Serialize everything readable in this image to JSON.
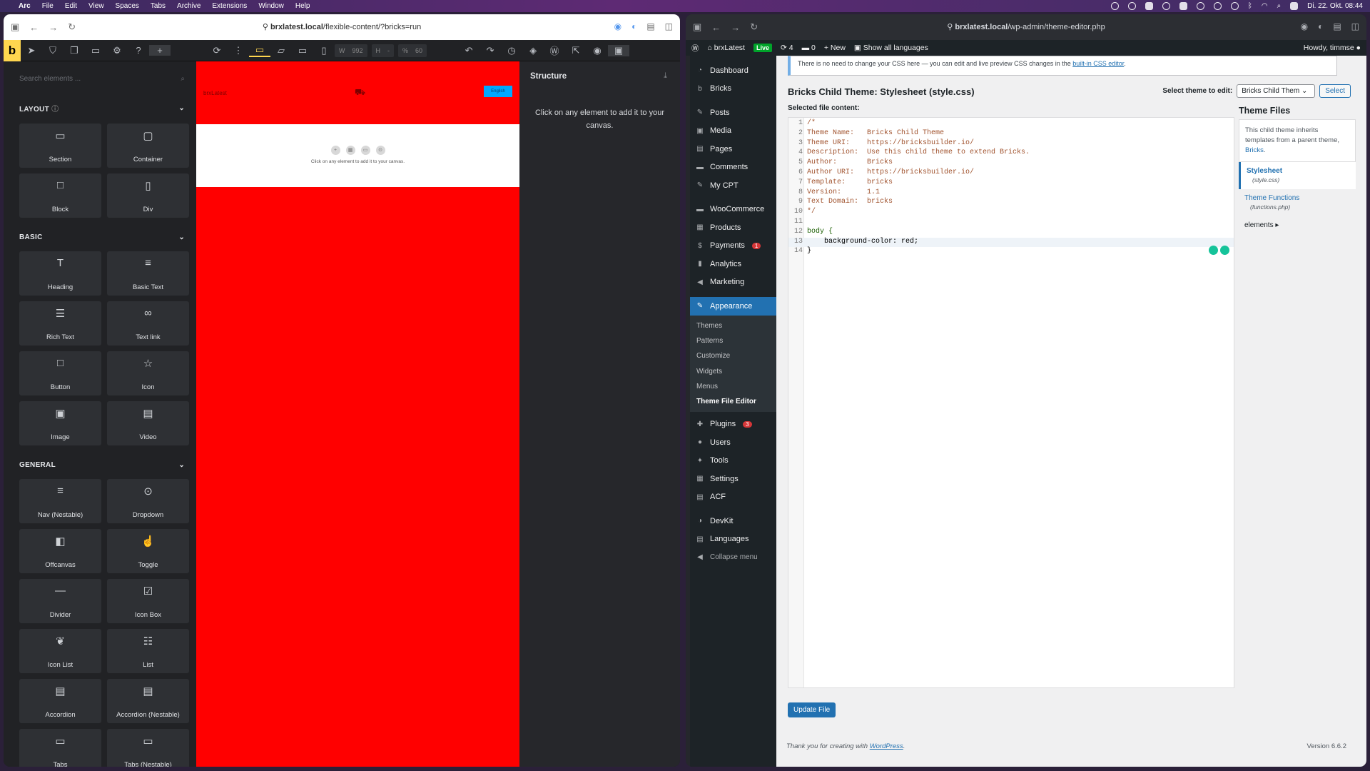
{
  "menubar": {
    "items": [
      "Arc",
      "File",
      "Edit",
      "View",
      "Spaces",
      "Tabs",
      "Archive",
      "Extensions",
      "Window",
      "Help"
    ],
    "clock": "Di. 22. Okt. 08:44"
  },
  "left_window": {
    "url_domain": "brxlatest.local",
    "url_path": "/flexible-content/?bricks=run",
    "toolbar": {
      "logo": "b",
      "width_label": "W",
      "width_value": "992",
      "height_label": "H",
      "height_value": "-",
      "pct_label": "%",
      "pct_value": "60"
    },
    "search_placeholder": "Search elements ...",
    "sections": [
      {
        "title": "LAYOUT",
        "items": [
          {
            "label": "Section",
            "glyph": "▭"
          },
          {
            "label": "Container",
            "glyph": "▢"
          },
          {
            "label": "Block",
            "glyph": "□"
          },
          {
            "label": "Div",
            "glyph": "▯"
          }
        ]
      },
      {
        "title": "BASIC",
        "items": [
          {
            "label": "Heading",
            "glyph": "T"
          },
          {
            "label": "Basic Text",
            "glyph": "≡"
          },
          {
            "label": "Rich Text",
            "glyph": "☰"
          },
          {
            "label": "Text link",
            "glyph": "⚲"
          },
          {
            "label": "Button",
            "glyph": "□"
          },
          {
            "label": "Icon",
            "glyph": "☆"
          },
          {
            "label": "Image",
            "glyph": "▣"
          },
          {
            "label": "Video",
            "glyph": "▤"
          }
        ]
      },
      {
        "title": "GENERAL",
        "items": [
          {
            "label": "Nav (Nestable)",
            "glyph": "≡"
          },
          {
            "label": "Dropdown",
            "glyph": "⌄"
          },
          {
            "label": "Offcanvas",
            "glyph": "◧"
          },
          {
            "label": "Toggle",
            "glyph": "☝"
          },
          {
            "label": "Divider",
            "glyph": "—"
          },
          {
            "label": "Icon Box",
            "glyph": "☑"
          },
          {
            "label": "Icon List",
            "glyph": "❦"
          },
          {
            "label": "List",
            "glyph": "☷"
          },
          {
            "label": "Accordion",
            "glyph": "▤"
          },
          {
            "label": "Accordion (Nestable)",
            "glyph": "▤"
          },
          {
            "label": "Tabs",
            "glyph": "▭"
          },
          {
            "label": "Tabs (Nestable)",
            "glyph": "▭"
          }
        ]
      }
    ],
    "canvas": {
      "logo": "brxLatest",
      "lang_button": "English",
      "empty_message": "Click on any element to add it to your canvas.",
      "bg": "#ff0000"
    },
    "structure": {
      "title": "Structure",
      "message": "Click on any element to add it to your canvas."
    }
  },
  "right_window": {
    "url_domain": "brxlatest.local",
    "url_path": "/wp-admin/theme-editor.php",
    "adminbar": {
      "site": "brxLatest",
      "live": "Live",
      "updates": "4",
      "comments": "0",
      "new": "New",
      "languages": "Show all languages",
      "howdy": "Howdy, timmse"
    },
    "sidebar": [
      {
        "label": "Dashboard",
        "icon": "◔"
      },
      {
        "label": "Bricks",
        "icon": "b"
      },
      {
        "gap": true
      },
      {
        "label": "Posts",
        "icon": "✎"
      },
      {
        "label": "Media",
        "icon": "▣"
      },
      {
        "label": "Pages",
        "icon": "▤"
      },
      {
        "label": "Comments",
        "icon": "▬"
      },
      {
        "label": "My CPT",
        "icon": "✎"
      },
      {
        "gap": true
      },
      {
        "label": "WooCommerce",
        "icon": "▬"
      },
      {
        "label": "Products",
        "icon": "▦"
      },
      {
        "label": "Payments",
        "icon": "$",
        "badge": "1"
      },
      {
        "label": "Analytics",
        "icon": "▮"
      },
      {
        "label": "Marketing",
        "icon": "◀"
      },
      {
        "gap": true
      },
      {
        "label": "Appearance",
        "icon": "✎",
        "current": true
      }
    ],
    "submenu": [
      "Themes",
      "Patterns",
      "Customize",
      "Widgets",
      "Menus",
      "Theme File Editor"
    ],
    "sidebar2": [
      {
        "label": "Plugins",
        "icon": "✚",
        "badge": "3"
      },
      {
        "label": "Users",
        "icon": "●"
      },
      {
        "label": "Tools",
        "icon": "✦"
      },
      {
        "label": "Settings",
        "icon": "▦"
      },
      {
        "label": "ACF",
        "icon": "▤"
      },
      {
        "gap": true
      },
      {
        "label": "DevKit",
        "icon": "◑"
      },
      {
        "label": "Languages",
        "icon": "▤"
      },
      {
        "label": "Collapse menu",
        "icon": "◀"
      }
    ],
    "notice_text": "There is no need to change your CSS here — you can edit and live preview CSS changes in the ",
    "notice_link": "built-in CSS editor",
    "page_title": "Bricks Child Theme: Stylesheet (style.css)",
    "select_label": "Select theme to edit:",
    "select_value": "Bricks Child Them",
    "select_button": "Select",
    "selected_file_label": "Selected file content:",
    "code_lines": [
      "/*",
      "Theme Name:   Bricks Child Theme",
      "Theme URI:    https://bricksbuilder.io/",
      "Description:  Use this child theme to extend Bricks.",
      "Author:       Bricks",
      "Author URI:   https://bricksbuilder.io/",
      "Template:     bricks",
      "Version:      1.1",
      "Text Domain:  bricks",
      "*/",
      "",
      "body {",
      "    background-color: red;",
      "}"
    ],
    "theme_files": {
      "title": "Theme Files",
      "info_text": "This child theme inherits templates from a parent theme, ",
      "info_link": "Bricks",
      "files": [
        {
          "name": "Stylesheet",
          "sub": "(style.css)",
          "active": true
        },
        {
          "name": "Theme Functions",
          "sub": "(functions.php)",
          "active": false
        }
      ],
      "folder": "elements ▸"
    },
    "update_button": "Update File",
    "footer_text": "Thank you for creating with ",
    "footer_link": "WordPress",
    "version": "Version 6.6.2"
  }
}
